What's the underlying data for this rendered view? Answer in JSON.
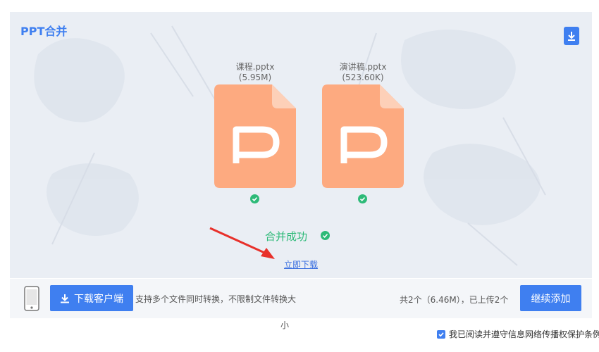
{
  "app": {
    "title": "PPT合并"
  },
  "files": [
    {
      "name": "课程.pptx",
      "size": "(5.95M)"
    },
    {
      "name": "演讲稿.pptx",
      "size": "(523.60K)"
    }
  ],
  "result": {
    "status": "合并成功",
    "download_link": "立即下载"
  },
  "bottom": {
    "client_button": "下载客户端",
    "promo_line1": "支持多个文件同时转换，不限制文件转换大",
    "promo_line2": "小",
    "summary": "共2个（6.46M），已上传2个",
    "add_button": "继续添加"
  },
  "agreement": {
    "text": "我已阅读并遵守信息网络传播权保护条例",
    "checked": true
  },
  "colors": {
    "accent": "#3f7ff0",
    "success": "#2dba78",
    "file_orange": "#fdaa80",
    "file_fold": "#fdd0b8",
    "arrow_red": "#e8302a"
  }
}
